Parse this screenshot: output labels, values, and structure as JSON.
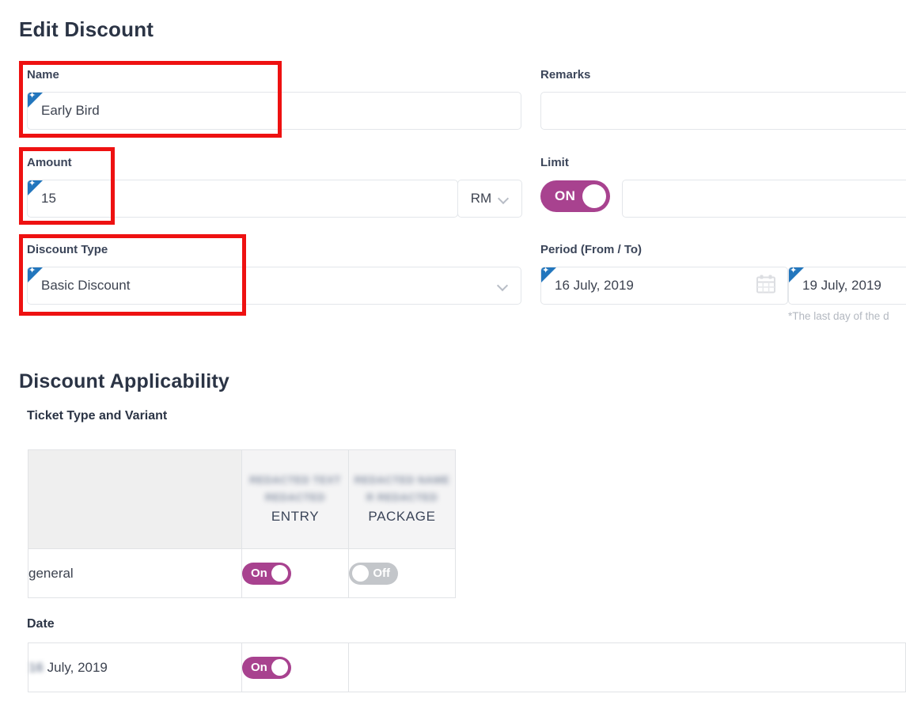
{
  "header": {
    "title": "Edit Discount"
  },
  "form": {
    "name": {
      "label": "Name",
      "value": "Early Bird",
      "required_badge": "required-star-icon"
    },
    "remarks": {
      "label": "Remarks",
      "value": "",
      "placeholder": ""
    },
    "amount": {
      "label": "Amount",
      "value": "15",
      "currency": "RM",
      "currency_chevron": "chevron-down-icon"
    },
    "limit": {
      "label": "Limit",
      "toggle_state": "ON",
      "value": "",
      "placeholder": ""
    },
    "discount_type": {
      "label": "Discount Type",
      "value": "Basic Discount",
      "chevron": "chevron-down-icon"
    },
    "period": {
      "label": "Period (From / To)",
      "from_value": "16 July, 2019",
      "to_value": "19 July, 2019",
      "calendar_icon": "calendar-icon",
      "hint": "*The last day of the d"
    }
  },
  "applicability": {
    "title": "Discount Applicability",
    "ticket_section_title": "Ticket Type and Variant",
    "table": {
      "columns": [
        {
          "name": "",
          "blurred_lines": [],
          "label": ""
        },
        {
          "name": "entry",
          "blurred_lines": [
            "REDACTED TEXT",
            "REDACTED"
          ],
          "label": "ENTRY"
        },
        {
          "name": "package",
          "blurred_lines": [
            "REDACTED NAME",
            "R REDACTED"
          ],
          "label": "PACKAGE"
        }
      ],
      "rows": [
        {
          "label": "general",
          "entry_toggle": "On",
          "entry_state": "on",
          "package_toggle": "Off",
          "package_state": "off"
        }
      ]
    },
    "date_section": {
      "title": "Date",
      "rows": [
        {
          "blurred_prefix": "16",
          "label": "July, 2019",
          "toggle": "On",
          "state": "on"
        }
      ]
    }
  },
  "annotations": {
    "highlight_color": "#ee1111",
    "boxes": [
      {
        "name": "name-field-highlight"
      },
      {
        "name": "amount-field-highlight"
      },
      {
        "name": "discount-type-field-highlight"
      }
    ]
  },
  "colors": {
    "toggle_on": "#a8428f",
    "toggle_off": "#c3c6ca",
    "required_badge": "#2276bd",
    "text_primary": "#2b3445"
  }
}
